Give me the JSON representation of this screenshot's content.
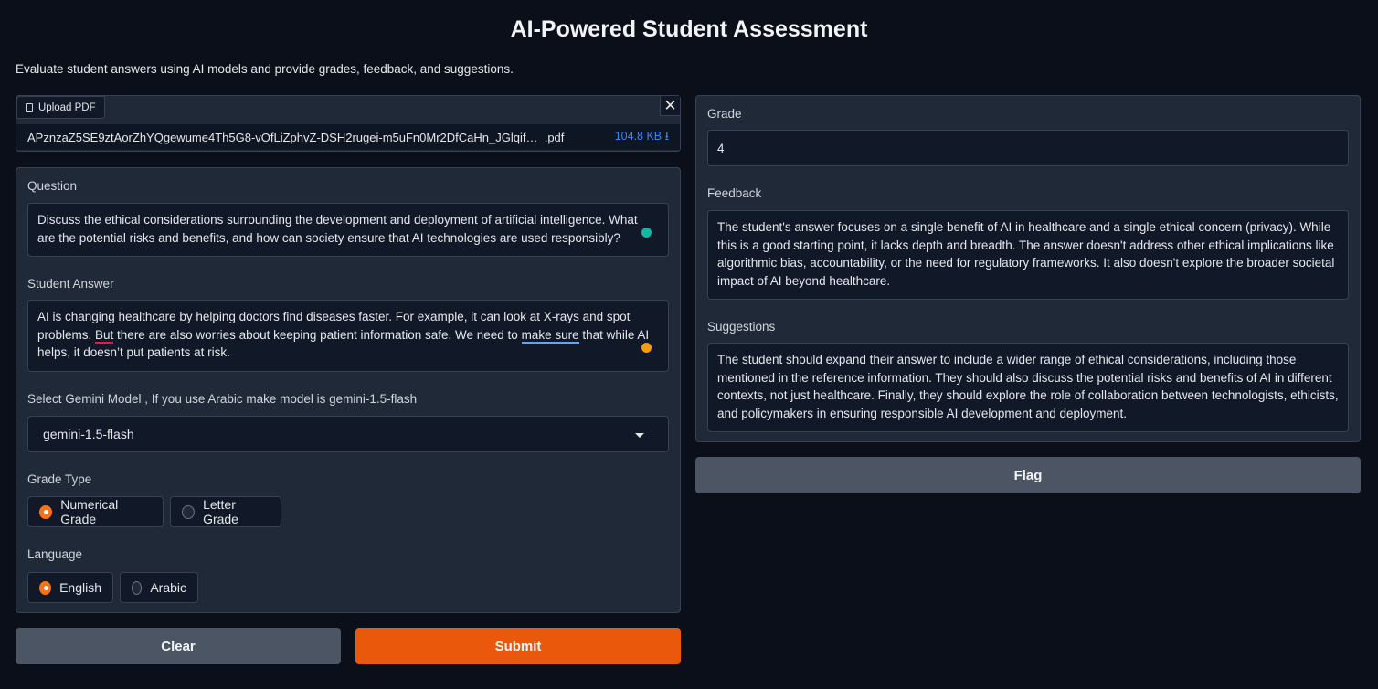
{
  "header": {
    "title": "AI-Powered Student Assessment",
    "subtitle": "Evaluate student answers using AI models and provide grades, feedback, and suggestions."
  },
  "upload": {
    "tab_label": "Upload PDF",
    "file_name": "APznzaZ5SE9ztAorZhYQgewume4Th5G8-vOfLiZphvZ-DSH2rugei-m5uFn0Mr2DfCaHn_JGlqif…",
    "file_ext": ".pdf",
    "file_size": "104.8 KB ⭳",
    "close_symbol": "✕"
  },
  "inputs": {
    "question_label": "Question",
    "question_value": "Discuss the ethical considerations surrounding the development and deployment of artificial intelligence. What are the potential risks and benefits, and how can society ensure that AI technologies are used responsibly?",
    "answer_label": "Student Answer",
    "answer_part1": "AI is changing healthcare by helping doctors find diseases faster. For example, it can look at X-rays and spot problems. ",
    "answer_word_but": "But",
    "answer_part2": " there are also worries about keeping patient information safe. We need to ",
    "answer_word_make_sure": "make sure",
    "answer_part3": " that while AI helps, it doesn’t put patients at risk.",
    "model_label": "Select Gemini Model , If you use Arabic make model is gemini-1.5-flash",
    "model_value": "gemini-1.5-flash",
    "grade_type_label": "Grade Type",
    "grade_type_options": [
      "Numerical Grade",
      "Letter Grade"
    ],
    "grade_type_selected": "Numerical Grade",
    "language_label": "Language",
    "language_options": [
      "English",
      "Arabic"
    ],
    "language_selected": "English"
  },
  "actions": {
    "clear_label": "Clear",
    "submit_label": "Submit",
    "flag_label": "Flag"
  },
  "outputs": {
    "grade_label": "Grade",
    "grade_value": "4",
    "feedback_label": "Feedback",
    "feedback_value": "The student's answer focuses on a single benefit of AI in healthcare and a single ethical concern (privacy). While this is a good starting point, it lacks depth and breadth. The answer doesn't address other ethical implications like algorithmic bias, accountability, or the need for regulatory frameworks. It also doesn't explore the broader societal impact of AI beyond healthcare.",
    "suggestions_label": "Suggestions",
    "suggestions_value": "The student should expand their answer to include a wider range of ethical considerations, including those mentioned in the reference information. They should also discuss the potential risks and benefits of AI in different contexts, not just healthcare. Finally, they should explore the role of collaboration between technologists, ethicists, and policymakers in ensuring responsible AI development and deployment."
  },
  "colors": {
    "background": "#0b0f19",
    "panel": "#1f2937",
    "accent": "#ea580c",
    "teal_indicator": "#14b8a6",
    "amber_indicator": "#f59e0b"
  }
}
